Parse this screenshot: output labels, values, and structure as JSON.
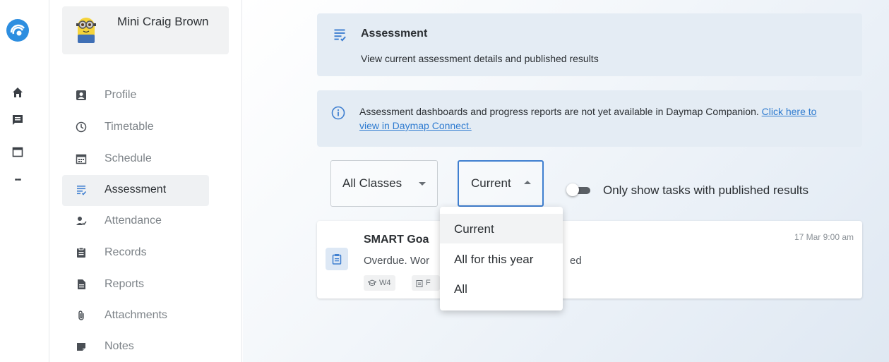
{
  "rail": {
    "icons": [
      "daymap-logo-icon",
      "home-icon",
      "chat-icon",
      "calendar-icon",
      "more-icon"
    ],
    "more_glyph": "•••"
  },
  "user": {
    "name": "Mini Craig Brown"
  },
  "nav": {
    "items": [
      {
        "label": "Profile",
        "icon": "profile-icon"
      },
      {
        "label": "Timetable",
        "icon": "clock-icon"
      },
      {
        "label": "Schedule",
        "icon": "schedule-icon"
      },
      {
        "label": "Assessment",
        "icon": "assessment-icon",
        "active": true
      },
      {
        "label": "Attendance",
        "icon": "attendance-icon"
      },
      {
        "label": "Records",
        "icon": "records-icon"
      },
      {
        "label": "Reports",
        "icon": "reports-icon"
      },
      {
        "label": "Attachments",
        "icon": "paperclip-icon"
      },
      {
        "label": "Notes",
        "icon": "notes-icon"
      }
    ]
  },
  "header": {
    "title": "Assessment",
    "subtitle": "View current assessment details and published results"
  },
  "info": {
    "text": "Assessment dashboards and progress reports are not yet available in Daymap Companion.",
    "link": "Click here to view in Daymap Connect."
  },
  "filters": {
    "class_label": "All Classes",
    "period_label": "Current",
    "toggle_label": "Only show tasks with published results",
    "toggle_on": false
  },
  "dropdown": {
    "options": [
      "Current",
      "All for this year",
      "All"
    ],
    "selected": "Current"
  },
  "task": {
    "title": "SMART Goa",
    "desc_start": "Overdue. Wor",
    "desc_end": "ed",
    "date": "17 Mar 9:00 am",
    "chip1": "W4",
    "chip2": "F"
  },
  "colors": {
    "accent": "#3f7fd0",
    "link": "#2e7bd0",
    "panel": "#e4ecf4"
  }
}
